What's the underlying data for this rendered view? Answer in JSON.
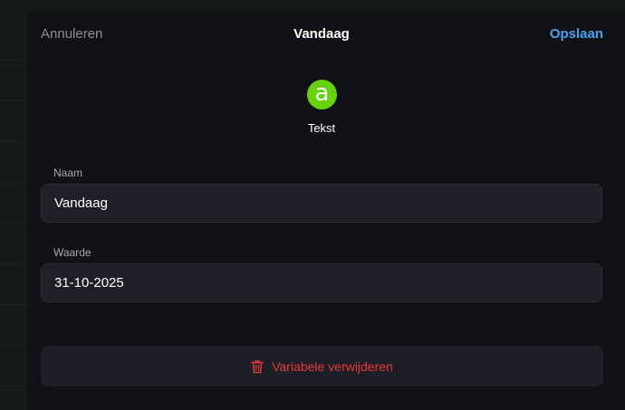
{
  "header": {
    "cancel_label": "Annuleren",
    "title": "Vandaag",
    "save_label": "Opslaan"
  },
  "type": {
    "icon_glyph": "a",
    "icon_name": "text-type-icon",
    "icon_color": "#67d20c",
    "label": "Tekst"
  },
  "fields": {
    "name": {
      "label": "Naam",
      "value": "Vandaag"
    },
    "value": {
      "label": "Waarde",
      "value": "31-10-2025"
    }
  },
  "actions": {
    "delete_label": "Variabele verwijderen",
    "delete_icon": "trash-icon",
    "delete_color": "#e8393c"
  },
  "colors": {
    "accent": "#4aa3f0",
    "background": "#101114",
    "field_bg": "#1f2027"
  }
}
